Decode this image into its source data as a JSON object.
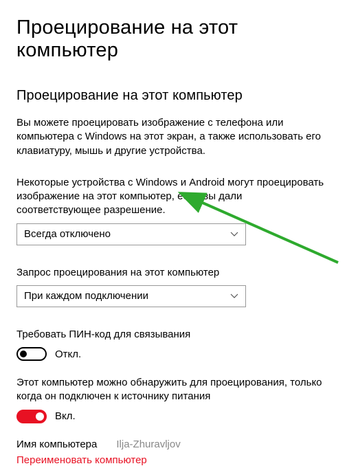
{
  "page": {
    "title": "Проецирование на этот компьютер",
    "section_heading": "Проецирование на этот компьютер",
    "intro": "Вы можете проецировать изображение с телефона или компьютера с Windows на этот экран, а также использовать его клавиатуру, мышь и другие устройства."
  },
  "fields": {
    "permission_label": "Некоторые устройства с Windows и Android могут проецировать изображение на этот компьютер, если вы дали соответствующее разрешение.",
    "permission_value": "Всегда отключено",
    "ask_label": "Запрос проецирования на этот компьютер",
    "ask_value": "При каждом подключении",
    "pin_label": "Требовать ПИН-код для связывания",
    "pin_state": "Откл.",
    "discover_label": "Этот компьютер можно обнаружить для проецирования, только когда он подключен к источнику питания",
    "discover_state": "Вкл."
  },
  "computer": {
    "name_label": "Имя компьютера",
    "name_value": "Ilja-Zhuravljov",
    "rename_link": "Переименовать компьютер"
  }
}
